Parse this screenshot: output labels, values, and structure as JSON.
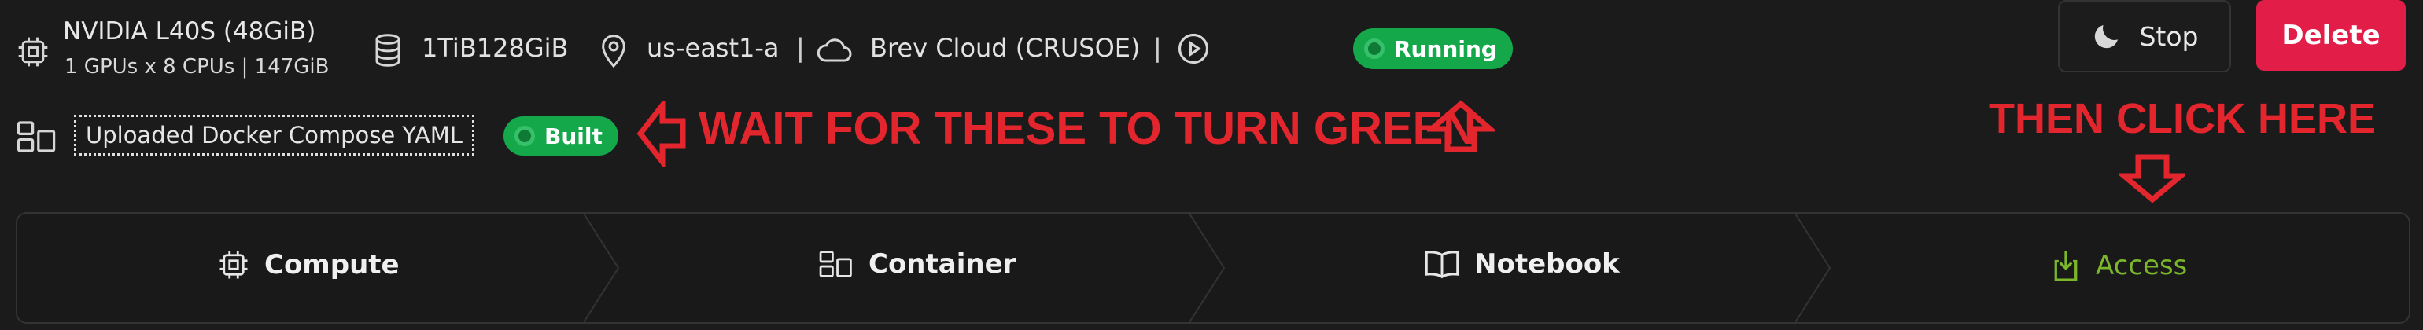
{
  "instance": {
    "gpu_name": "NVIDIA L40S (48GiB)",
    "gpu_specs": "1 GPUs x 8 CPUs | 147GiB",
    "storage": "1TiB128GiB",
    "region": "us-east1-a",
    "region_sep": "|",
    "provider": "Brev Cloud (CRUSOE)",
    "provider_sep": "|",
    "status": "Running"
  },
  "container": {
    "source_label": "Uploaded Docker Compose YAML",
    "build_status": "Built"
  },
  "actions": {
    "stop_label": "Stop",
    "delete_label": "Delete"
  },
  "annotations": {
    "wait_text": "WAIT FOR THESE TO TURN GREEN",
    "click_text": "THEN CLICK HERE",
    "color": "#e3262e"
  },
  "steps": [
    {
      "label": "Compute",
      "icon": "chip-icon"
    },
    {
      "label": "Container",
      "icon": "container-icon"
    },
    {
      "label": "Notebook",
      "icon": "book-icon"
    },
    {
      "label": "Access",
      "icon": "download-icon",
      "active": true
    }
  ],
  "colors": {
    "status_green": "#14a84b",
    "delete_red": "#e11d48",
    "active_step": "#7cb62b"
  }
}
